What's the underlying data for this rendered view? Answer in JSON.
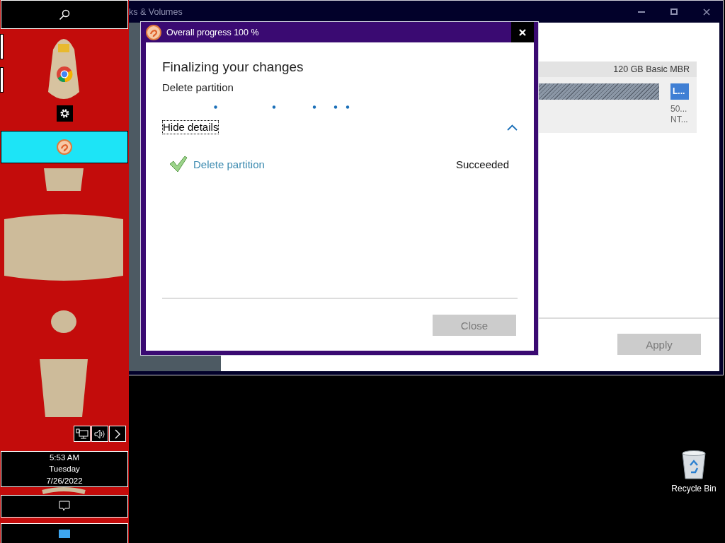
{
  "taskbar": {
    "apps": [
      {
        "selected": false
      },
      {
        "selected": true
      }
    ],
    "clock": {
      "time": "5:53 AM",
      "day": "Tuesday",
      "date": "7/26/2022"
    }
  },
  "background_window": {
    "title": "ks & Volumes",
    "disk": {
      "header": "120 GB Basic MBR",
      "partition_label": "L...",
      "partition_lines": [
        "50...",
        "NT..."
      ]
    },
    "apply_button": {
      "label": "Apply",
      "disabled": true
    }
  },
  "dialog": {
    "title": "Overall progress 100 %",
    "heading": "Finalizing your changes",
    "current_operation": "Delete partition",
    "details_toggle": {
      "label": "Hide details",
      "expanded": true
    },
    "operations": [
      {
        "name": "Delete partition",
        "status": "Succeeded"
      }
    ],
    "close_button": {
      "label": "Close",
      "disabled": true
    }
  },
  "desktop_icons": [
    {
      "label": "Recycle Bin"
    }
  ]
}
